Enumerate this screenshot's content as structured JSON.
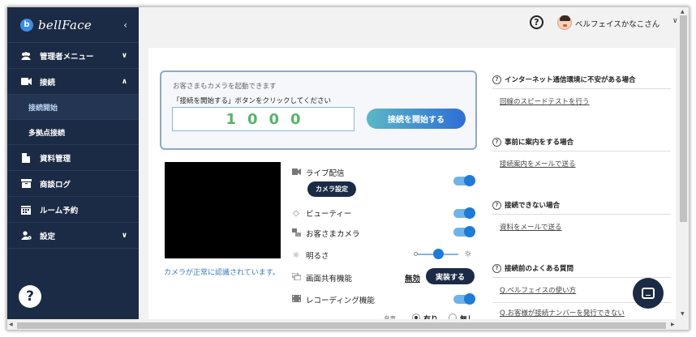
{
  "sidebar": {
    "logo_letter": "b",
    "logo_text": "bellFace",
    "collapse_icon": "chevron-left-icon",
    "items": [
      {
        "label": "管理者メニュー",
        "icon": "users-icon",
        "chevron": "∨"
      },
      {
        "label": "接続",
        "icon": "video-icon",
        "chevron": "∧"
      },
      {
        "label": "接続開始",
        "sub": true,
        "active": true
      },
      {
        "label": "多拠点接続",
        "sub": true
      },
      {
        "label": "資料管理",
        "icon": "document-icon"
      },
      {
        "label": "商談ログ",
        "icon": "archive-icon"
      },
      {
        "label": "ルーム予約",
        "icon": "calendar-icon"
      },
      {
        "label": "設定",
        "icon": "user-gear-icon",
        "chevron": "∨"
      }
    ],
    "help_label": "?"
  },
  "topbar": {
    "help_label": "?",
    "user_name": "ベルフェイスかなこさん"
  },
  "connect": {
    "hint": "お客さまもカメラを起動できます",
    "instruction": "「接続を開始する」ボタンをクリックしてください",
    "number": "1000",
    "start_button": "接続を開始する"
  },
  "camera_status": "カメラが正常に認識されています。",
  "settings": {
    "live": "ライブ配信",
    "camera_settings_button": "カメラ設定",
    "beauty": "ビューティー",
    "customer_camera": "お客さまカメラ",
    "brightness": "明るさ",
    "brightness_level": 0.55,
    "screen_share": "画面共有機能",
    "screen_share_status": "無効",
    "implement_button": "実装する",
    "recording": "レコーディング機能",
    "audio_label": "音声",
    "audio_on": "有り",
    "audio_off": "無し"
  },
  "help": [
    {
      "title": "インターネット通信環境に不安がある場合",
      "links": [
        "回線のスピードテストを行う"
      ]
    },
    {
      "title": "事前に案内をする場合",
      "links": [
        "接続案内をメールで送る"
      ]
    },
    {
      "title": "接続できない場合",
      "links": [
        "資料をメールで送る"
      ]
    },
    {
      "title": "接続前のよくある質問",
      "links": [
        "Q.ベルフェイスの使い方",
        "Q.お客様が接続ナンバーを発行できない"
      ]
    }
  ],
  "colors": {
    "sidebar": "#1c2b45",
    "accent": "#1f7bd6",
    "number": "#58b368"
  }
}
